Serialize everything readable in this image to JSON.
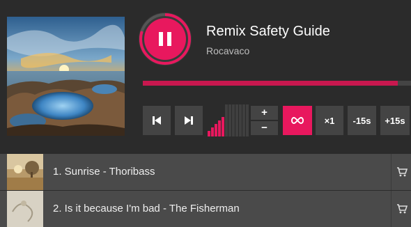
{
  "player": {
    "title": "Remix Safety Guide",
    "artist": "Rocavaco",
    "progress_fraction": 0.95,
    "playback_icon": "pause-icon",
    "volume_bars_active": 5,
    "volume_bars_total": 12,
    "controls": {
      "prev_icon": "skip-back-icon",
      "next_icon": "skip-forward-icon",
      "volume_up_label": "+",
      "volume_down_label": "−",
      "loop_icon": "loop-icon",
      "speed_label": "×1",
      "rewind_label": "-15s",
      "forward_label": "+15s"
    }
  },
  "colors": {
    "accent": "#e8185e",
    "progress": "#c8184f",
    "background": "#2b2b2b",
    "button": "#444444"
  },
  "playlist": [
    {
      "label": "1. Sunrise - Thoribass",
      "action_icon": "cart-icon"
    },
    {
      "label": "2. Is it because I'm bad - The Fisherman",
      "action_icon": "cart-icon"
    }
  ]
}
